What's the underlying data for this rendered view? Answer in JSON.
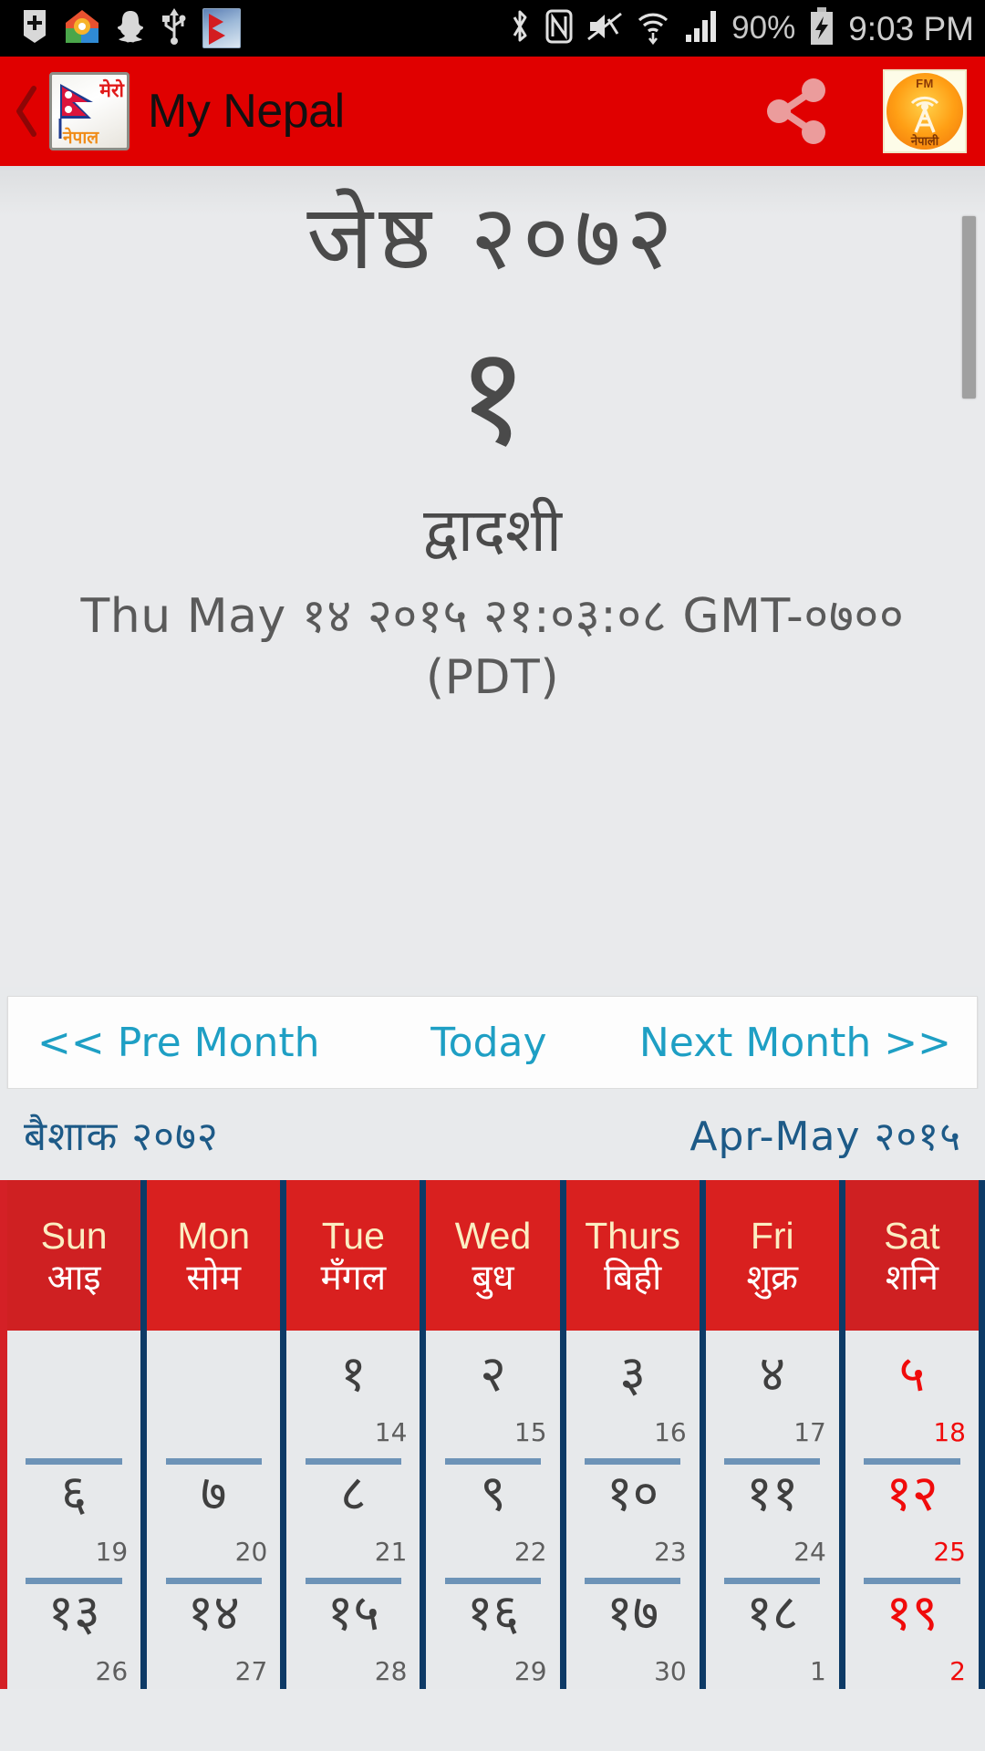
{
  "status_bar": {
    "time": "9:03 PM",
    "battery_pct": "90%",
    "left_icons": [
      "plus-badge-icon",
      "home-app-icon",
      "snapchat-icon",
      "usb-icon",
      "nepal-flag-app-icon"
    ],
    "right_icons": [
      "bluetooth-icon",
      "nfc-icon",
      "mute-icon",
      "wifi-icon",
      "signal-icon",
      "battery-charging-icon"
    ]
  },
  "app_bar": {
    "title": "My Nepal",
    "back_icon": "back-chevron-icon",
    "logo": {
      "mero_text": "मेरो",
      "nepal_text": "नेपाल"
    },
    "share_icon": "share-icon",
    "fm_button": {
      "label": "FM",
      "sub": "नेपाली"
    },
    "bar_color": "#e00000"
  },
  "date_panel": {
    "bs_month_year": "जेष्ठ २०७२",
    "bs_day": "१",
    "tithi": "द्वादशी",
    "ad_datetime": "Thu May १४ २०१५ २१:०३:०८ GMT-०७०० (PDT)"
  },
  "nav": {
    "prev_label": "<< Pre Month",
    "today_label": "Today",
    "next_label": "Next Month >>",
    "link_color": "#1e9fc4"
  },
  "month_labels": {
    "bs": "बैशाक २०७२",
    "ad": "Apr-May २०१५",
    "color": "#1d5a87"
  },
  "calendar": {
    "header_color": "#d9201f",
    "divider_color": "#0d3a66",
    "holiday_color": "#f00b0b",
    "headers": [
      {
        "en": "Sun",
        "np": "आइ"
      },
      {
        "en": "Mon",
        "np": "सोम"
      },
      {
        "en": "Tue",
        "np": "मँगल"
      },
      {
        "en": "Wed",
        "np": "बुध"
      },
      {
        "en": "Thurs",
        "np": "बिही"
      },
      {
        "en": "Fri",
        "np": "शुक्र"
      },
      {
        "en": "Sat",
        "np": "शनि"
      }
    ],
    "rows": [
      [
        {
          "bs": "",
          "ad": "",
          "empty": true,
          "holiday": false
        },
        {
          "bs": "",
          "ad": "",
          "empty": true,
          "holiday": false
        },
        {
          "bs": "१",
          "ad": "14",
          "empty": false,
          "holiday": false
        },
        {
          "bs": "२",
          "ad": "15",
          "empty": false,
          "holiday": false
        },
        {
          "bs": "३",
          "ad": "16",
          "empty": false,
          "holiday": false
        },
        {
          "bs": "४",
          "ad": "17",
          "empty": false,
          "holiday": false
        },
        {
          "bs": "५",
          "ad": "18",
          "empty": false,
          "holiday": true
        }
      ],
      [
        {
          "bs": "६",
          "ad": "19",
          "empty": false,
          "holiday": false
        },
        {
          "bs": "७",
          "ad": "20",
          "empty": false,
          "holiday": false
        },
        {
          "bs": "८",
          "ad": "21",
          "empty": false,
          "holiday": false
        },
        {
          "bs": "९",
          "ad": "22",
          "empty": false,
          "holiday": false
        },
        {
          "bs": "१०",
          "ad": "23",
          "empty": false,
          "holiday": false
        },
        {
          "bs": "११",
          "ad": "24",
          "empty": false,
          "holiday": false
        },
        {
          "bs": "१२",
          "ad": "25",
          "empty": false,
          "holiday": true
        }
      ],
      [
        {
          "bs": "१३",
          "ad": "26",
          "empty": false,
          "holiday": false
        },
        {
          "bs": "१४",
          "ad": "27",
          "empty": false,
          "holiday": false
        },
        {
          "bs": "१५",
          "ad": "28",
          "empty": false,
          "holiday": false
        },
        {
          "bs": "१६",
          "ad": "29",
          "empty": false,
          "holiday": false
        },
        {
          "bs": "१७",
          "ad": "30",
          "empty": false,
          "holiday": false
        },
        {
          "bs": "१८",
          "ad": "1",
          "empty": false,
          "holiday": false
        },
        {
          "bs": "१९",
          "ad": "2",
          "empty": false,
          "holiday": true
        }
      ]
    ]
  }
}
